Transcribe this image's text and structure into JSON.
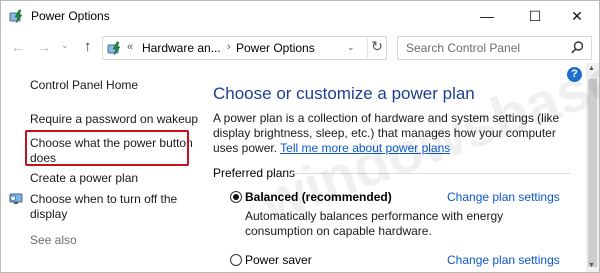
{
  "window": {
    "title": "Power Options",
    "controls": {
      "minimize": "—",
      "maximize": "☐",
      "close": "✕"
    }
  },
  "nav": {
    "back": "←",
    "forward": "→",
    "recent": "⌄",
    "up": "↑"
  },
  "address": {
    "overflow": "«",
    "crumbs": [
      "Hardware an...",
      "Power Options"
    ],
    "separator": "›",
    "dropdown": "⌄",
    "refresh": "↻"
  },
  "search": {
    "placeholder": "Search Control Panel"
  },
  "left_pane": {
    "home": "Control Panel Home",
    "links": {
      "require_password": "Require a password on wakeup",
      "choose_power_button": "Choose what the power button does",
      "create_plan": "Create a power plan",
      "turn_off_display": "Choose when to turn off the display"
    },
    "see_also": "See also"
  },
  "main": {
    "help": "?",
    "heading": "Choose or customize a power plan",
    "description": "A power plan is a collection of hardware and system settings (like display brightness, sleep, etc.) that manages how your computer uses power.",
    "learn_more": "Tell me more about power plans",
    "preferred_title": "Preferred plans",
    "plans": [
      {
        "name": "Balanced (recommended)",
        "selected": true,
        "description": "Automatically balances performance with energy consumption on capable hardware.",
        "change_label": "Change plan settings"
      },
      {
        "name": "Power saver",
        "selected": false,
        "description": "",
        "change_label": "Change plan settings"
      }
    ]
  },
  "colors": {
    "heading": "#1d3f91",
    "link": "#0a58ca",
    "highlight": "#c1121f",
    "help_bg": "#1e6fce"
  },
  "icons": {
    "app": "power-options-icon",
    "search": "search-icon",
    "turn_off": "display-icon"
  }
}
